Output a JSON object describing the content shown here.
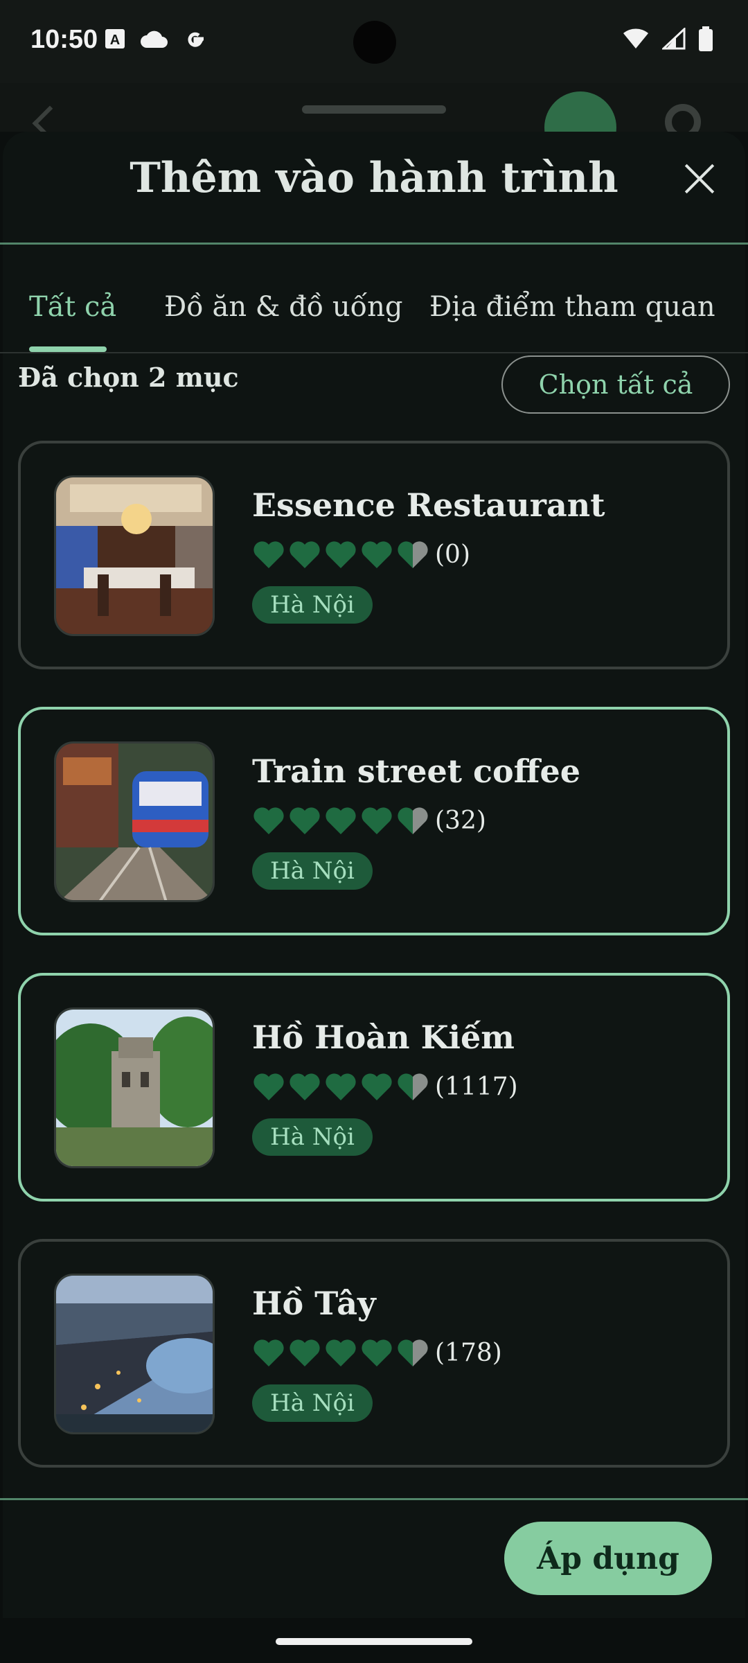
{
  "status_bar": {
    "time": "10:50"
  },
  "sheet": {
    "title": "Thêm vào hành trình",
    "tabs": [
      {
        "label": "Tất cả",
        "active": true
      },
      {
        "label": "Đồ ăn & đồ uống",
        "active": false
      },
      {
        "label": "Địa điểm tham quan",
        "active": false
      }
    ],
    "selected_count": "Đã chọn 2 mục",
    "select_all_label": "Chọn tất cả",
    "items": [
      {
        "name": "Essence Restaurant",
        "rating_count": "(0)",
        "rating": 4.5,
        "tag": "Hà Nội",
        "selected": false
      },
      {
        "name": "Train street coffee",
        "rating_count": "(32)",
        "rating": 4.5,
        "tag": "Hà Nội",
        "selected": true
      },
      {
        "name": "Hồ Hoàn Kiếm",
        "rating_count": "(1117)",
        "rating": 4.5,
        "tag": "Hà Nội",
        "selected": true
      },
      {
        "name": "Hồ Tây",
        "rating_count": "(178)",
        "rating": 4.5,
        "tag": "Hà Nội",
        "selected": false
      }
    ],
    "apply_label": "Áp dụng"
  },
  "colors": {
    "accent": "#8fd3ac",
    "heart_full": "#1f6b41",
    "heart_empty": "#8a8f8c",
    "tag_bg": "#1e5a3a",
    "apply_bg": "#86cca0"
  }
}
